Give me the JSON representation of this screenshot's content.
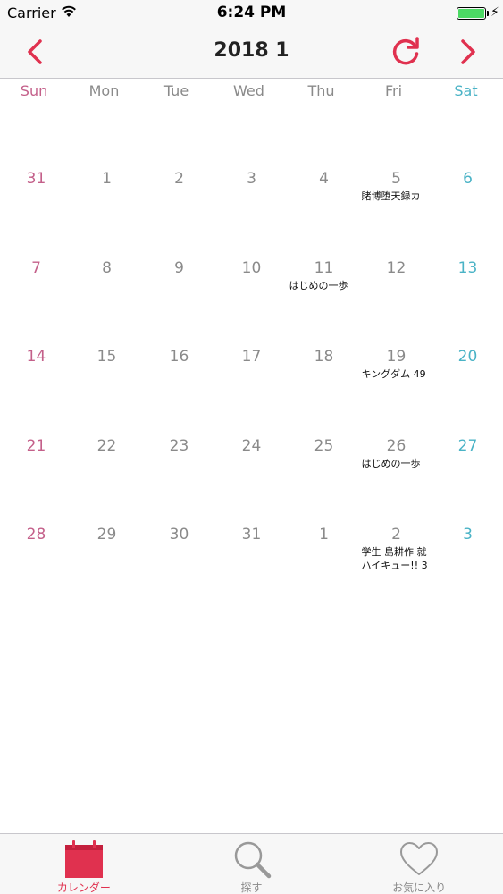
{
  "status": {
    "carrier": "Carrier",
    "time": "6:24 PM",
    "battery_level": 1.0
  },
  "nav": {
    "title": "2018 1"
  },
  "weekdays": [
    "Sun",
    "Mon",
    "Tue",
    "Wed",
    "Thu",
    "Fri",
    "Sat"
  ],
  "weeks": [
    {
      "days": [
        {
          "num": "31",
          "events": []
        },
        {
          "num": "1",
          "events": []
        },
        {
          "num": "2",
          "events": []
        },
        {
          "num": "3",
          "events": []
        },
        {
          "num": "4",
          "events": []
        },
        {
          "num": "5",
          "events": [
            "賭博堕天録カ"
          ]
        },
        {
          "num": "6",
          "events": []
        }
      ]
    },
    {
      "days": [
        {
          "num": "7",
          "events": []
        },
        {
          "num": "8",
          "events": []
        },
        {
          "num": "9",
          "events": []
        },
        {
          "num": "10",
          "events": []
        },
        {
          "num": "11",
          "events": [
            "はじめの一歩"
          ]
        },
        {
          "num": "12",
          "events": []
        },
        {
          "num": "13",
          "events": []
        }
      ]
    },
    {
      "days": [
        {
          "num": "14",
          "events": []
        },
        {
          "num": "15",
          "events": []
        },
        {
          "num": "16",
          "events": []
        },
        {
          "num": "17",
          "events": []
        },
        {
          "num": "18",
          "events": []
        },
        {
          "num": "19",
          "events": [
            "キングダム 49"
          ]
        },
        {
          "num": "20",
          "events": []
        }
      ]
    },
    {
      "days": [
        {
          "num": "21",
          "events": []
        },
        {
          "num": "22",
          "events": []
        },
        {
          "num": "23",
          "events": []
        },
        {
          "num": "24",
          "events": []
        },
        {
          "num": "25",
          "events": []
        },
        {
          "num": "26",
          "events": [
            "はじめの一歩"
          ]
        },
        {
          "num": "27",
          "events": []
        }
      ]
    },
    {
      "days": [
        {
          "num": "28",
          "events": []
        },
        {
          "num": "29",
          "events": []
        },
        {
          "num": "30",
          "events": []
        },
        {
          "num": "31",
          "events": []
        },
        {
          "num": "1",
          "events": []
        },
        {
          "num": "2",
          "events": [
            "学生 島耕作 就",
            "ハイキュー!! 3"
          ]
        },
        {
          "num": "3",
          "events": []
        }
      ]
    }
  ],
  "tabs": [
    {
      "label": "カレンダー",
      "icon": "calendar-icon",
      "active": true
    },
    {
      "label": "探す",
      "icon": "search-icon",
      "active": false
    },
    {
      "label": "お気に入り",
      "icon": "heart-icon",
      "active": false
    }
  ],
  "colors": {
    "accent": "#e0314f",
    "sunday": "#c4608a",
    "saturday": "#4ab3c6",
    "weekday": "#8a8a8a"
  }
}
